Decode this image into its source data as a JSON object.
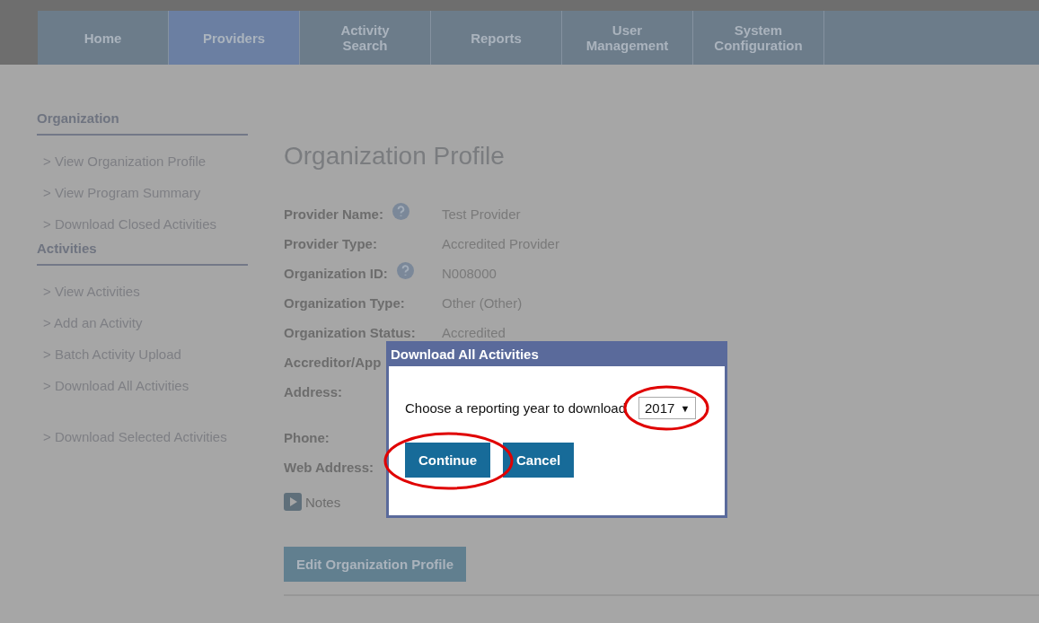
{
  "nav": [
    {
      "label": "Home",
      "selected": false
    },
    {
      "label": "Providers",
      "selected": true
    },
    {
      "label": "Activity Search",
      "selected": false
    },
    {
      "label": "Reports",
      "selected": false
    },
    {
      "label": "User Management",
      "selected": false
    },
    {
      "label": "System Configuration",
      "selected": false
    }
  ],
  "sidebar": [
    {
      "heading": "Organization",
      "items": [
        "> View Organization Profile",
        "> View Program Summary",
        "> Download Closed Activities"
      ]
    },
    {
      "heading": "Activities",
      "items": [
        "> View Activities",
        "> Add an Activity",
        "> Batch Activity Upload",
        "> Download All Activities",
        "> Download Selected Activities"
      ]
    }
  ],
  "profile": {
    "title": "Organization Profile",
    "fields": [
      {
        "label": "Provider Name:",
        "help": true,
        "value": "Test Provider"
      },
      {
        "label": "Provider Type:",
        "help": false,
        "value": "Accredited Provider"
      },
      {
        "label": "Organization ID:",
        "help": true,
        "value": "N008000"
      },
      {
        "label": "Organization Type:",
        "help": false,
        "value": "Other (Other)"
      },
      {
        "label": "Organization Status:",
        "help": false,
        "value": "Accredited"
      },
      {
        "label": "Accreditor/App",
        "help": false
      },
      {
        "label": "Address:",
        "help": false,
        "kind": "tall"
      },
      {
        "label": "Phone:",
        "help": false
      },
      {
        "label": "Web Address:",
        "help": false
      }
    ],
    "notes": {
      "label": "Notes",
      "expanded": false
    },
    "edit_button": "Edit Organization Profile"
  },
  "dialog": {
    "title": "Download All Activities",
    "prompt": "Choose a reporting year to download",
    "year": "2017",
    "year_arrow": "▼",
    "year_highlighted": true,
    "buttons": [
      {
        "label": "Continue",
        "highlighted": true
      },
      {
        "label": "Cancel",
        "highlighted": false
      }
    ]
  }
}
